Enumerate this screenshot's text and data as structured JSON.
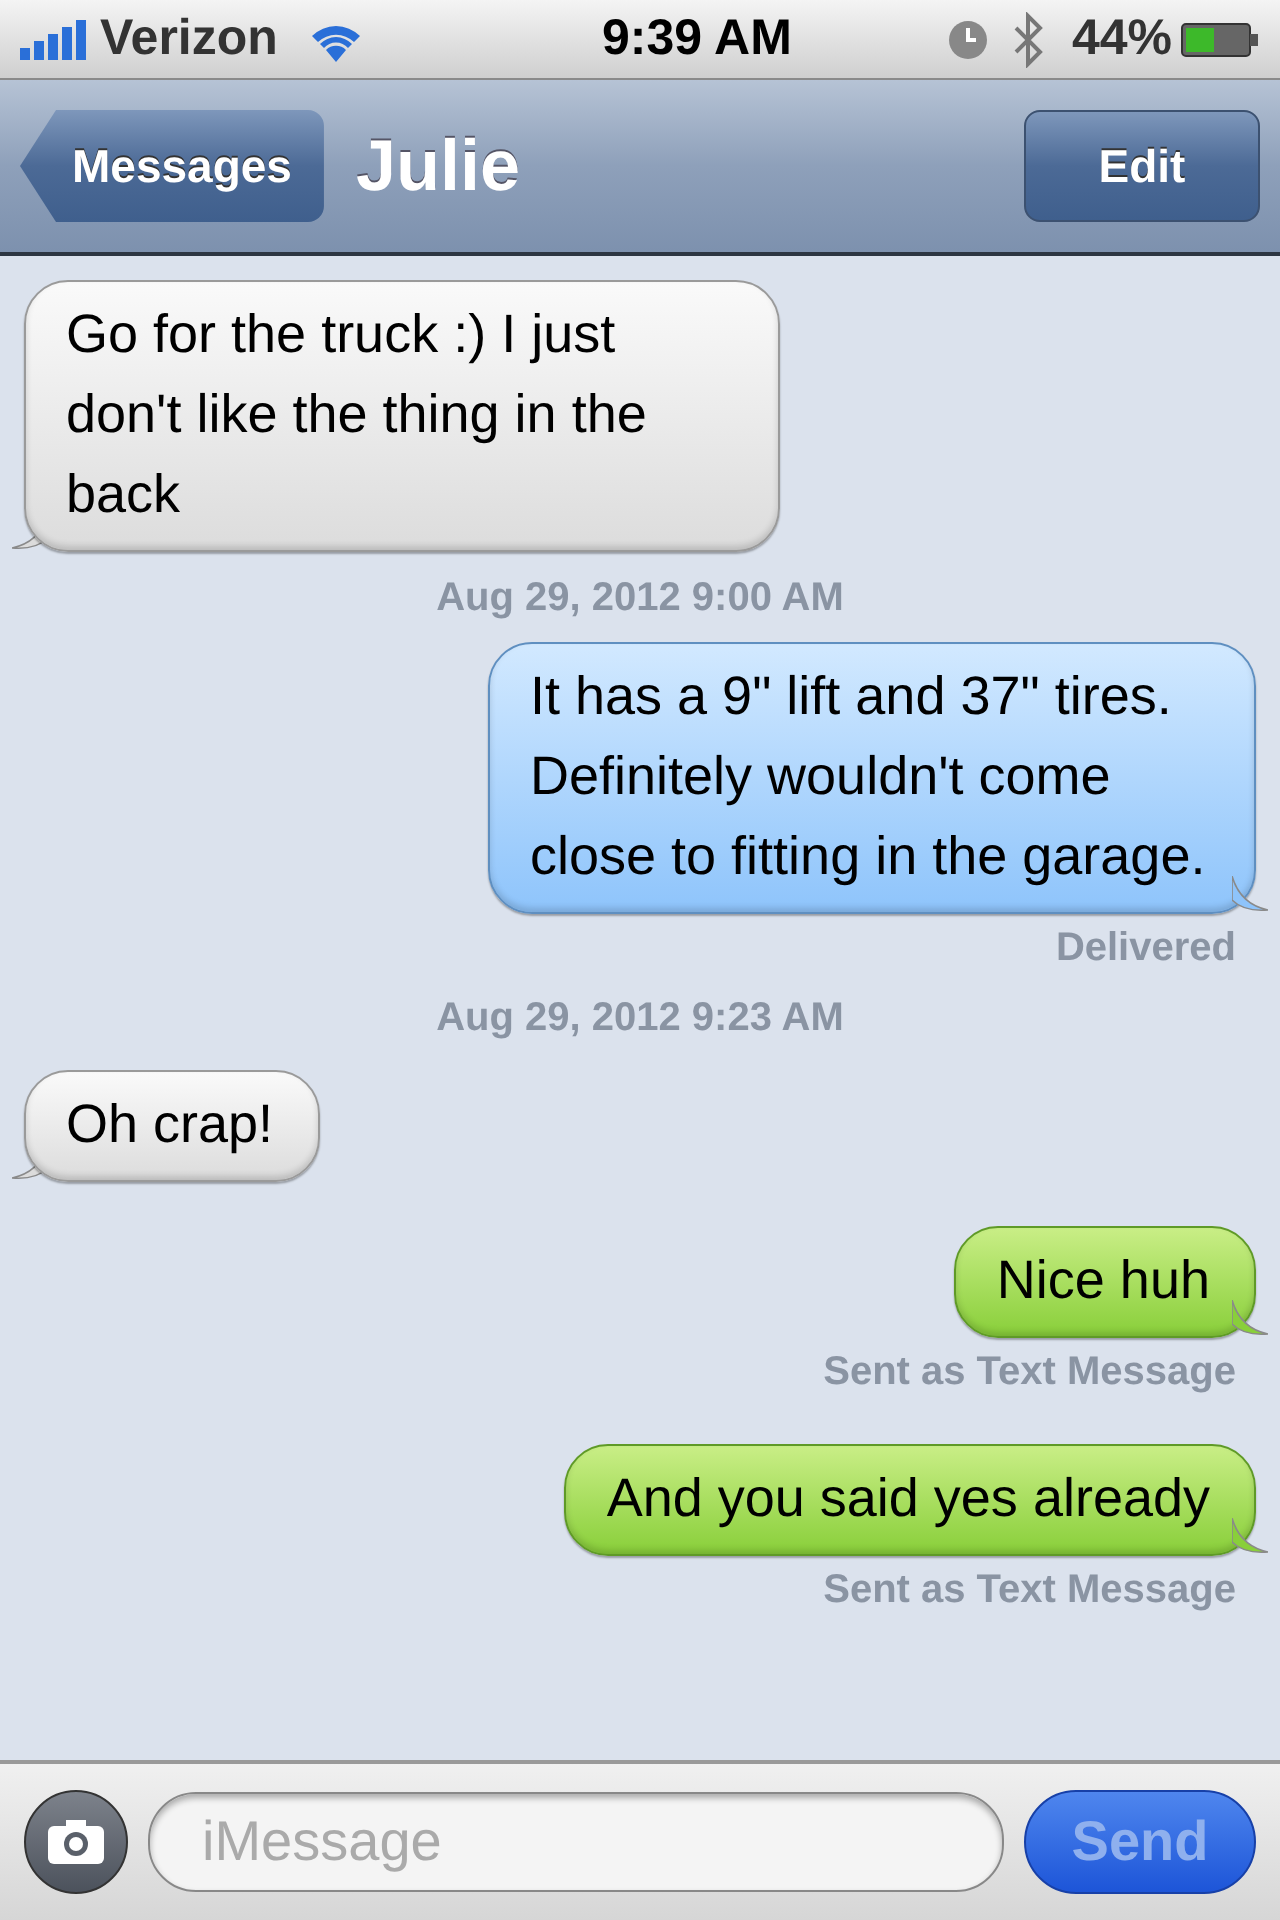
{
  "status_bar": {
    "carrier": "Verizon",
    "time": "9:39 AM",
    "battery": "44%"
  },
  "nav_bar": {
    "back": "Messages",
    "title": "Julie",
    "edit": "Edit"
  },
  "messages": [
    {
      "kind": "received",
      "text": "Go for the truck :) I just don't like the thing in the back"
    },
    {
      "kind": "timestamp",
      "text": "Aug 29, 2012 9:00 AM"
    },
    {
      "kind": "sent_imessage",
      "text": "It has a 9\" lift and 37\" tires. Definitely wouldn't come close to fitting in the garage.",
      "status": "Delivered"
    },
    {
      "kind": "timestamp",
      "text": "Aug 29, 2012 9:23 AM"
    },
    {
      "kind": "received",
      "text": "Oh crap!"
    },
    {
      "kind": "sent_sms",
      "text": "Nice huh",
      "status": "Sent as Text Message"
    },
    {
      "kind": "sent_sms",
      "text": "And you said yes already",
      "status": "Sent as Text Message"
    }
  ],
  "composer": {
    "placeholder": "iMessage",
    "send": "Send",
    "send_disabled": true
  }
}
